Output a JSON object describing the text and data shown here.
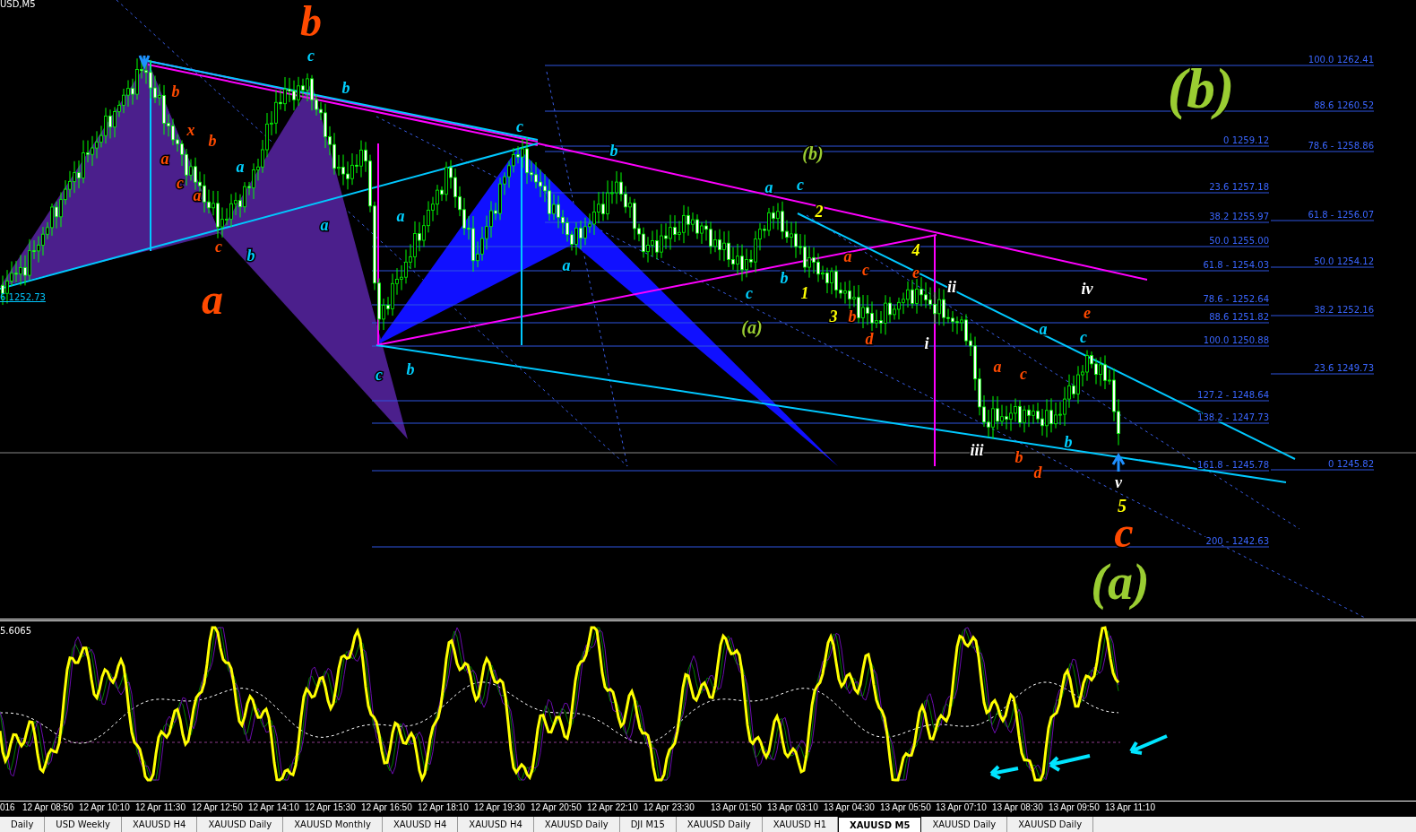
{
  "chart": {
    "symbol_label": "USD,M5",
    "price_tag": "6 1252.73",
    "fib_levels_left": [
      "0 1259.12",
      "23.6 1257.18",
      "38.2 1255.97",
      "50.0 1255.00",
      "61.8 - 1254.03",
      "78.6 - 1252.64",
      "88.6 1251.82",
      "100.0 1250.88",
      "127.2 - 1248.64",
      "138.2 - 1247.73",
      "161.8 -  1245.78",
      "200 - 1242.63"
    ],
    "fib_levels_right": [
      "100.0 1262.41",
      "88.6 1260.52",
      "78.6 - 1258.86",
      "61.8 - 1256.07",
      "50.0 1254.12",
      "38.2 1252.16",
      "23.6 1249.73",
      "0 1245.82"
    ],
    "wave_labels": [
      {
        "text": "a",
        "color": "#ff4a00"
      },
      {
        "text": "b",
        "color": "#ff4a00"
      },
      {
        "text": "c",
        "color": "#ff4a00"
      },
      {
        "text": "x",
        "color": "#ff4a00"
      },
      {
        "text": "a",
        "color": "#ff4a00"
      },
      {
        "text": "b",
        "color": "#ff4a00"
      },
      {
        "text": "c",
        "color": "#ff4a00"
      },
      {
        "text": "a",
        "color": "#ff4a00"
      },
      {
        "text": "a",
        "color": "#00d0ff"
      },
      {
        "text": "b",
        "color": "#00d0ff"
      },
      {
        "text": "b",
        "color": "#ff4a00"
      },
      {
        "text": "c",
        "color": "#00d0ff"
      },
      {
        "text": "a",
        "color": "#00d0ff"
      },
      {
        "text": "b",
        "color": "#00d0ff"
      },
      {
        "text": "c",
        "color": "#00d0ff"
      },
      {
        "text": "a",
        "color": "#00d0ff"
      },
      {
        "text": "b",
        "color": "#00d0ff"
      },
      {
        "text": "c",
        "color": "#00d0ff"
      },
      {
        "text": "a",
        "color": "#00d0ff"
      },
      {
        "text": "b",
        "color": "#00d0ff"
      },
      {
        "text": "c",
        "color": "#00d0ff"
      },
      {
        "text": "(a)",
        "color": "#9acd32"
      },
      {
        "text": "a",
        "color": "#00d0ff"
      },
      {
        "text": "b",
        "color": "#00d0ff"
      },
      {
        "text": "(b)",
        "color": "#9acd32"
      },
      {
        "text": "c",
        "color": "#00d0ff"
      },
      {
        "text": "1",
        "color": "#ffff00"
      },
      {
        "text": "2",
        "color": "#ffff00"
      },
      {
        "text": "3",
        "color": "#ffff00"
      },
      {
        "text": "a",
        "color": "#ff4a00"
      },
      {
        "text": "b",
        "color": "#ff4a00"
      },
      {
        "text": "c",
        "color": "#ff4a00"
      },
      {
        "text": "d",
        "color": "#ff4a00"
      },
      {
        "text": "4",
        "color": "#ffff00"
      },
      {
        "text": "e",
        "color": "#ff4a00"
      },
      {
        "text": "i",
        "color": "#ffffff"
      },
      {
        "text": "ii",
        "color": "#ffffff"
      },
      {
        "text": "iii",
        "color": "#ffffff"
      },
      {
        "text": "a",
        "color": "#ff4a00"
      },
      {
        "text": "c",
        "color": "#ff4a00"
      },
      {
        "text": "b",
        "color": "#ff4a00"
      },
      {
        "text": "a",
        "color": "#00d0ff"
      },
      {
        "text": "d",
        "color": "#ff4a00"
      },
      {
        "text": "b",
        "color": "#00d0ff"
      },
      {
        "text": "iv",
        "color": "#ffffff"
      },
      {
        "text": "e",
        "color": "#ff4a00"
      },
      {
        "text": "c",
        "color": "#00d0ff"
      },
      {
        "text": "v",
        "color": "#ffffff"
      },
      {
        "text": "5",
        "color": "#ffff00"
      },
      {
        "text": "c",
        "color": "#ff4a00"
      },
      {
        "text": "(a)",
        "color": "#9acd32"
      },
      {
        "text": "(b)",
        "color": "#9acd32"
      }
    ]
  },
  "oscillator": {
    "value_label": "5.6065"
  },
  "time_axis": {
    "labels": [
      "016",
      "12 Apr 08:50",
      "12 Apr 10:10",
      "12 Apr 11:30",
      "12 Apr 12:50",
      "12 Apr 14:10",
      "12 Apr 15:30",
      "12 Apr 16:50",
      "12 Apr 18:10",
      "12 Apr 19:30",
      "12 Apr 20:50",
      "12 Apr 22:10",
      "12 Apr 23:30",
      "13 Apr 01:50",
      "13 Apr 03:10",
      "13 Apr 04:30",
      "13 Apr 05:50",
      "13 Apr 07:10",
      "13 Apr 08:30",
      "13 Apr 09:50",
      "13 Apr 11:10"
    ]
  },
  "tabs": [
    {
      "label": "Daily",
      "selected": false
    },
    {
      "label": "USD Weekly",
      "selected": false
    },
    {
      "label": "XAUUSD H4",
      "selected": false
    },
    {
      "label": "XAUUSD Daily",
      "selected": false
    },
    {
      "label": "XAUUSD Monthly",
      "selected": false
    },
    {
      "label": "XAUUSD H4",
      "selected": false
    },
    {
      "label": "XAUUSD H4",
      "selected": false
    },
    {
      "label": "XAUUSD Daily",
      "selected": false
    },
    {
      "label": "DJI M15",
      "selected": false
    },
    {
      "label": "XAUUSD Daily",
      "selected": false
    },
    {
      "label": "XAUUSD H1",
      "selected": false
    },
    {
      "label": "XAUUSD M5",
      "selected": true
    },
    {
      "label": "XAUUSD Daily",
      "selected": false
    },
    {
      "label": "XAUUSD Daily",
      "selected": false
    }
  ]
}
